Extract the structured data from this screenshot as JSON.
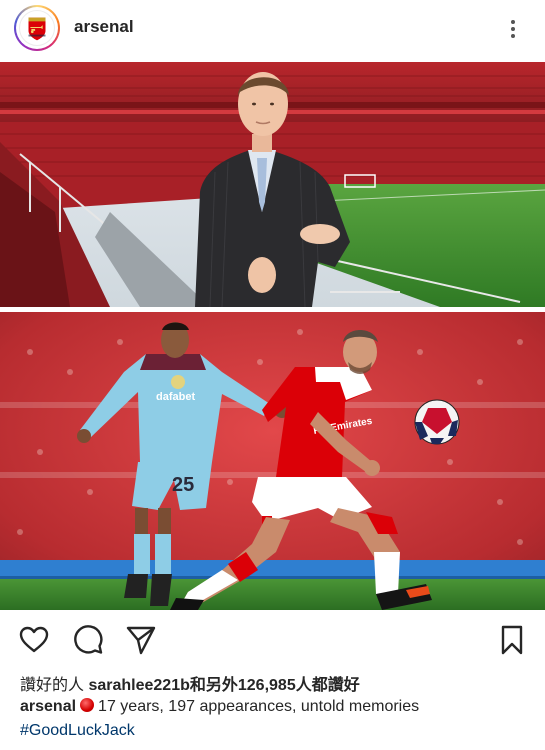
{
  "post": {
    "username": "arsenal",
    "more_icon": "more-vertical-icon"
  },
  "photo": {
    "top_alt": "Young Jack Wilshere in suit at Emirates Stadium",
    "bottom_alt": "Wilshere in Arsenal kit dribbling past Burnley player number 25",
    "opponent_shirt_sponsor": "dafabet",
    "opponent_shirt_number": "25",
    "arsenal_shirt_sponsor": "Fly Emirates"
  },
  "actions": {
    "like_icon": "heart-icon",
    "comment_icon": "comment-icon",
    "share_icon": "send-icon",
    "save_icon": "bookmark-icon"
  },
  "likes": {
    "prefix": "讚好的人 ",
    "user": "sarahlee221b",
    "middle": "和另外",
    "count": "126,985",
    "suffix": "人都讚好"
  },
  "caption": {
    "user": "arsenal",
    "text": "17 years, 197 appearances, untold memories",
    "hashtag": "#GoodLuckJack"
  },
  "colors": {
    "arsenal_red": "#db0007",
    "burnley_sky": "#7fc4e0",
    "pitch_green": "#3f8a2e",
    "hashtag_blue": "#00376b"
  }
}
